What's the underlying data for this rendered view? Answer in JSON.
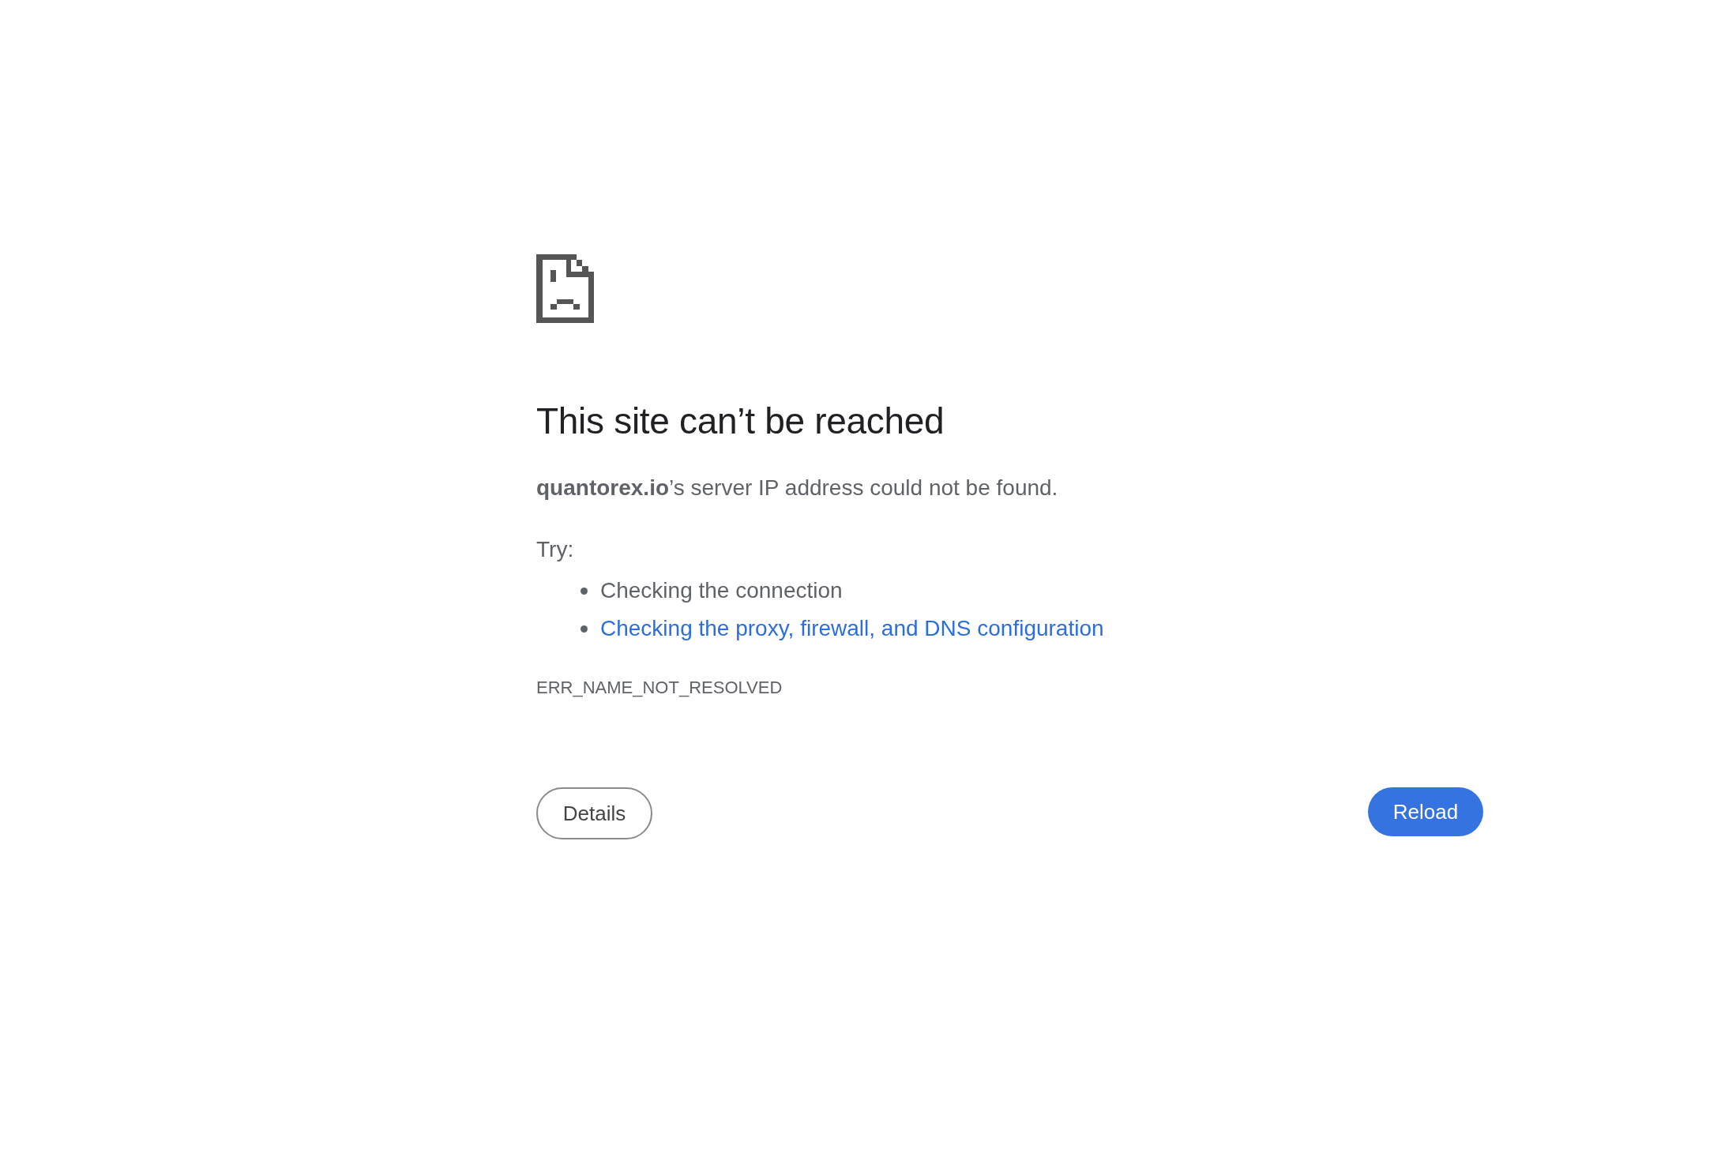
{
  "heading": "This site can’t be reached",
  "message": "**quantorex.io**’s server IP address could not be found.",
  "try_label": "Try:",
  "suggestions": [
    {
      "text": "Checking the connection",
      "kind": "text"
    },
    {
      "text": "Checking the proxy, firewall, and DNS configuration",
      "kind": "link"
    }
  ],
  "error_code": "ERR_NAME_NOT_RESOLVED",
  "buttons": [
    {
      "label": "Details",
      "kind": "secondary"
    },
    {
      "label": "Reload",
      "kind": "primary"
    }
  ]
}
